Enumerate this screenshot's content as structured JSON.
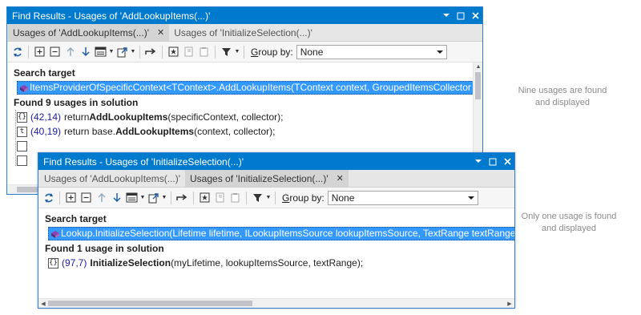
{
  "window1": {
    "title": "Find Results - Usages of 'AddLookupItems(...)'",
    "tabs": [
      {
        "label": "Usages of 'AddLookupItems(...)'",
        "close": "✕"
      },
      {
        "label": "Usages of 'InitializeSelection(...)'"
      }
    ],
    "groupby_label_prefix": "",
    "groupby_label_underlined": "G",
    "groupby_label_rest": "roup by:",
    "groupby_value": "None",
    "search_target_heading": "Search target",
    "search_target_text": "ItemsProviderOfSpecificContext<TContext>.AddLookupItems(TContext context, GroupedItemsCollector",
    "found_heading": "Found 9 usages in solution",
    "usages": [
      {
        "icon": "{}",
        "pos": "(42,14)",
        "pre": "return ",
        "bold": "AddLookupItems",
        "post": "(specificContext, collector);"
      },
      {
        "icon": "t",
        "pos": "(40,19)",
        "pre": "return base.",
        "bold": "AddLookupItems",
        "post": "(context, collector);"
      }
    ]
  },
  "window2": {
    "title": "Find Results - Usages of 'InitializeSelection(...)'",
    "tabs": [
      {
        "label": "Usages of 'AddLookupItems(...)'"
      },
      {
        "label": "Usages of 'InitializeSelection(...)'",
        "close": "✕"
      }
    ],
    "groupby_label_underlined": "G",
    "groupby_label_rest": "roup by:",
    "groupby_value": "None",
    "search_target_heading": "Search target",
    "search_target_text": "Lookup.InitializeSelection(Lifetime lifetime, ILookupItemsSource lookupItemsSource, TextRange textRange",
    "found_heading": "Found 1 usage in solution",
    "usages": [
      {
        "icon": "{}",
        "pos": "(97,7)",
        "pre": "",
        "bold": "InitializeSelection",
        "post": "(myLifetime, lookupItemsSource, textRange);"
      }
    ]
  },
  "notes": {
    "note1_line1": "Nine usages are found",
    "note1_line2": "and displayed",
    "note2_line1": "Only one usage is found",
    "note2_line2": "and displayed"
  },
  "colors": {
    "title_bar": "#007acc",
    "selection": "#3399ff",
    "position_text": "#1a1aa6"
  },
  "icons": [
    "refresh-icon",
    "expand-all-icon",
    "collapse-all-icon",
    "previous-icon",
    "next-icon",
    "filter-panel-icon",
    "export-icon",
    "goto-icon",
    "mark-icon",
    "copy-icon",
    "paste-icon",
    "filter-icon"
  ]
}
